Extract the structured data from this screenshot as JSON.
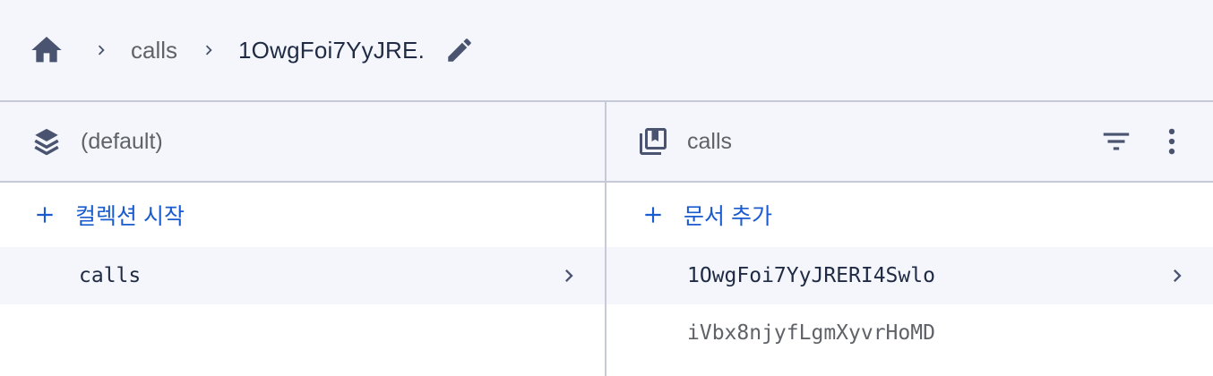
{
  "breadcrumb": {
    "home_icon": "home-icon",
    "items": [
      "calls",
      "1OwgFoi7YyJRE."
    ],
    "edit_icon": "pencil-icon"
  },
  "left_panel": {
    "icon": "database-stack-icon",
    "title": "(default)",
    "add_label": "컬렉션 시작",
    "items": [
      {
        "label": "calls",
        "selected": true
      }
    ]
  },
  "right_panel": {
    "icon": "collection-icon",
    "title": "calls",
    "actions": [
      "filter-icon",
      "more-vert-icon"
    ],
    "add_label": "문서 추가",
    "items": [
      {
        "label": "1OwgFoi7YyJRERI4Swlo",
        "selected": true
      },
      {
        "label": "iVbx8njyfLgmXyvrHoMD",
        "selected": false
      }
    ]
  },
  "colors": {
    "accent": "#1a5bd0",
    "header_bg": "#f4f6fb",
    "divider": "#c5cad6",
    "icon": "#4a5470"
  }
}
